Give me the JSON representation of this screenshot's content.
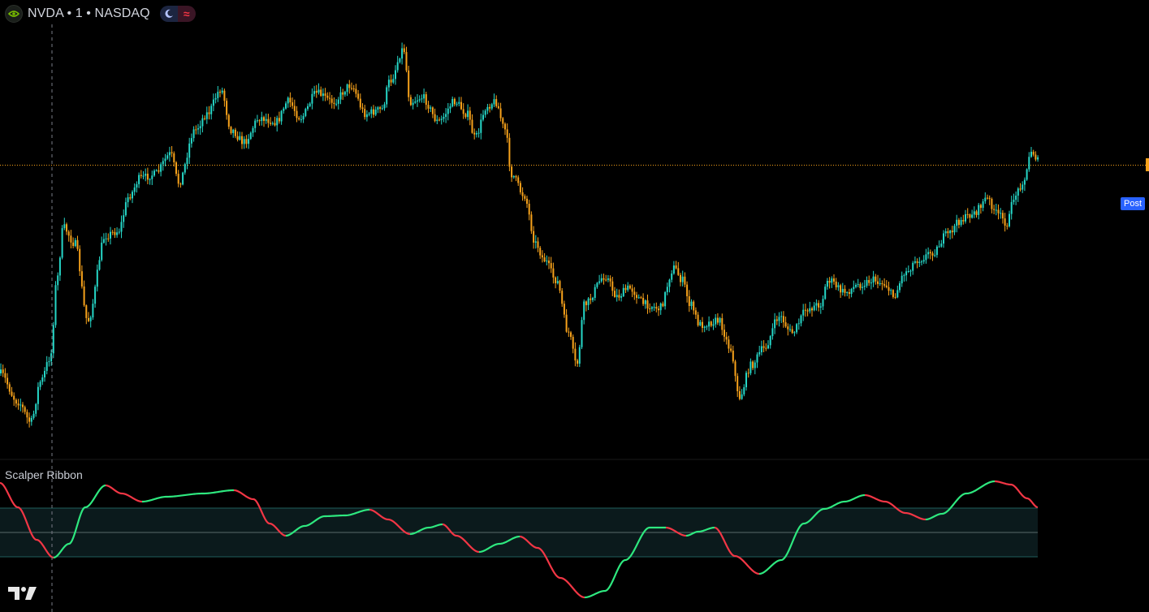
{
  "header": {
    "symbol_line": "NVDA • 1 • NASDAQ",
    "logo_icon": "nvidia-icon",
    "session_icon": "moon-icon",
    "wave_icon": "wave-icon"
  },
  "post_label": "Post",
  "indicator": {
    "title": "Scalper Ribbon"
  },
  "colors": {
    "background": "#000000",
    "up": "#26d7c7",
    "down": "#f7a21b",
    "ribbon_up": "#2ee87f",
    "ribbon_down": "#f23645",
    "band_fill": "#0b1a1c",
    "band_line": "#1f5f5c",
    "midline": "#5a6a6a",
    "crosshair": "#787b86",
    "price_line": "#f7a21b",
    "post_badge": "#2962ff"
  },
  "chart_data": [
    {
      "type": "candlestick",
      "title": "NVDA • 1 • NASDAQ",
      "price_anchors": [
        [
          0,
          460
        ],
        [
          22,
          495
        ],
        [
          38,
          520
        ],
        [
          50,
          470
        ],
        [
          62,
          440
        ],
        [
          70,
          345
        ],
        [
          78,
          280
        ],
        [
          92,
          300
        ],
        [
          108,
          395
        ],
        [
          130,
          290
        ],
        [
          145,
          285
        ],
        [
          160,
          240
        ],
        [
          172,
          220
        ],
        [
          190,
          215
        ],
        [
          210,
          190
        ],
        [
          220,
          225
        ],
        [
          240,
          160
        ],
        [
          255,
          140
        ],
        [
          272,
          110
        ],
        [
          285,
          160
        ],
        [
          300,
          175
        ],
        [
          320,
          145
        ],
        [
          340,
          150
        ],
        [
          355,
          125
        ],
        [
          370,
          145
        ],
        [
          390,
          115
        ],
        [
          410,
          125
        ],
        [
          432,
          105
        ],
        [
          450,
          140
        ],
        [
          470,
          135
        ],
        [
          480,
          100
        ],
        [
          497,
          60
        ],
        [
          505,
          125
        ],
        [
          520,
          120
        ],
        [
          540,
          150
        ],
        [
          560,
          125
        ],
        [
          575,
          140
        ],
        [
          585,
          170
        ],
        [
          600,
          130
        ],
        [
          610,
          125
        ],
        [
          622,
          160
        ],
        [
          630,
          215
        ],
        [
          645,
          240
        ],
        [
          660,
          300
        ],
        [
          670,
          320
        ],
        [
          685,
          345
        ],
        [
          700,
          410
        ],
        [
          710,
          450
        ],
        [
          720,
          375
        ],
        [
          745,
          340
        ],
        [
          760,
          365
        ],
        [
          775,
          355
        ],
        [
          795,
          375
        ],
        [
          812,
          380
        ],
        [
          830,
          330
        ],
        [
          840,
          345
        ],
        [
          850,
          375
        ],
        [
          862,
          400
        ],
        [
          885,
          395
        ],
        [
          900,
          430
        ],
        [
          910,
          490
        ],
        [
          925,
          450
        ],
        [
          940,
          430
        ],
        [
          960,
          390
        ],
        [
          975,
          410
        ],
        [
          995,
          380
        ],
        [
          1010,
          375
        ],
        [
          1020,
          345
        ],
        [
          1040,
          360
        ],
        [
          1060,
          350
        ],
        [
          1075,
          345
        ],
        [
          1090,
          350
        ],
        [
          1100,
          365
        ],
        [
          1115,
          335
        ],
        [
          1130,
          320
        ],
        [
          1150,
          310
        ],
        [
          1165,
          290
        ],
        [
          1185,
          270
        ],
        [
          1200,
          262
        ],
        [
          1215,
          245
        ],
        [
          1230,
          265
        ],
        [
          1240,
          275
        ],
        [
          1250,
          240
        ],
        [
          1262,
          220
        ],
        [
          1270,
          185
        ],
        [
          1280,
          200
        ]
      ],
      "crosshair_x": 64,
      "last_price_level": 203.5,
      "x_range": [
        0,
        1415
      ],
      "y_range": [
        0,
        565
      ]
    },
    {
      "type": "line",
      "title": "Scalper Ribbon",
      "band": [
        626,
        686
      ],
      "midline": 656,
      "y_range": [
        565,
        754
      ],
      "ribbon_anchors": [
        [
          0,
          595
        ],
        [
          22,
          625
        ],
        [
          45,
          665
        ],
        [
          66,
          687
        ],
        [
          85,
          670
        ],
        [
          105,
          625
        ],
        [
          130,
          598
        ],
        [
          150,
          608
        ],
        [
          175,
          618
        ],
        [
          205,
          612
        ],
        [
          250,
          608
        ],
        [
          288,
          604
        ],
        [
          312,
          615
        ],
        [
          332,
          645
        ],
        [
          352,
          660
        ],
        [
          375,
          648
        ],
        [
          400,
          636
        ],
        [
          425,
          635
        ],
        [
          455,
          628
        ],
        [
          478,
          640
        ],
        [
          505,
          658
        ],
        [
          528,
          650
        ],
        [
          545,
          646
        ],
        [
          562,
          660
        ],
        [
          590,
          680
        ],
        [
          615,
          670
        ],
        [
          640,
          661
        ],
        [
          662,
          675
        ],
        [
          690,
          712
        ],
        [
          720,
          736
        ],
        [
          745,
          728
        ],
        [
          770,
          690
        ],
        [
          800,
          650
        ],
        [
          820,
          650
        ],
        [
          845,
          660
        ],
        [
          860,
          655
        ],
        [
          880,
          650
        ],
        [
          905,
          685
        ],
        [
          935,
          707
        ],
        [
          962,
          690
        ],
        [
          990,
          645
        ],
        [
          1015,
          627
        ],
        [
          1040,
          618
        ],
        [
          1065,
          610
        ],
        [
          1090,
          618
        ],
        [
          1115,
          632
        ],
        [
          1140,
          640
        ],
        [
          1160,
          633
        ],
        [
          1190,
          608
        ],
        [
          1225,
          593
        ],
        [
          1245,
          597
        ],
        [
          1265,
          614
        ],
        [
          1278,
          625
        ]
      ],
      "x_range": [
        0,
        1415
      ]
    }
  ]
}
